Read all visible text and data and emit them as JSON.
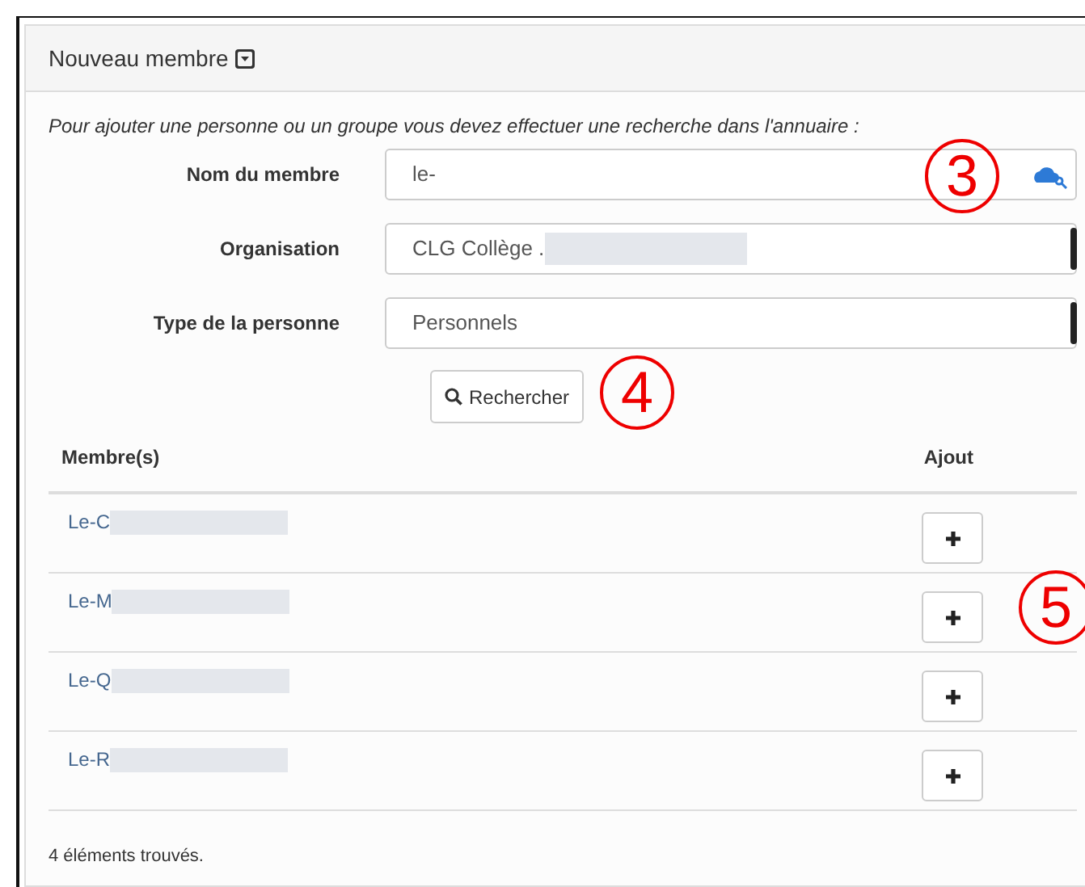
{
  "panel": {
    "title": "Nouveau membre",
    "expanded": true
  },
  "intro": "Pour ajouter une personne ou un groupe vous devez effectuer une recherche dans l'annuaire :",
  "fields": [
    {
      "kind": "input",
      "label": "Nom du membre",
      "value": "le-",
      "annotation": "3"
    },
    {
      "kind": "select",
      "label": "Organisation",
      "value": "CLG Collège .",
      "redacted": true
    },
    {
      "kind": "select",
      "label": "Type de la personne",
      "value": "Personnels",
      "redacted": false
    }
  ],
  "search_button": {
    "label": "Rechercher",
    "annotation": "4"
  },
  "table": {
    "columns": [
      "Membre(s)",
      "Ajout"
    ],
    "rows": [
      {
        "name": "Le-C",
        "redacted": true
      },
      {
        "name": "Le-M",
        "redacted": true,
        "annotation": "5"
      },
      {
        "name": "Le-Q",
        "redacted": true
      },
      {
        "name": "Le-R",
        "redacted": true
      }
    ]
  },
  "footer": "4 éléments trouvés."
}
